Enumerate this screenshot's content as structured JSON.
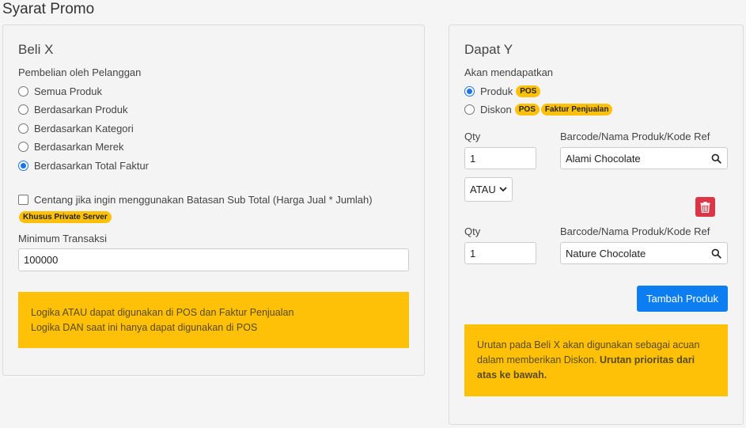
{
  "page": {
    "title": "Syarat Promo"
  },
  "left": {
    "title": "Beli X",
    "purchase_label": "Pembelian oleh Pelanggan",
    "options": [
      {
        "label": "Semua Produk",
        "checked": false
      },
      {
        "label": "Berdasarkan Produk",
        "checked": false
      },
      {
        "label": "Berdasarkan Kategori",
        "checked": false
      },
      {
        "label": "Berdasarkan Merek",
        "checked": false
      },
      {
        "label": "Berdasarkan Total Faktur",
        "checked": true
      }
    ],
    "checkbox_label": "Centang jika ingin menggunakan Batasan Sub Total (Harga Jual * Jumlah)",
    "private_badge": "Khusus Private Server",
    "min_label": "Minimum Transaksi",
    "min_value": "100000",
    "alert_line1": "Logika ATAU dapat digunakan di POS dan Faktur Penjualan",
    "alert_line2": "Logika DAN saat ini hanya dapat digunakan di POS"
  },
  "right": {
    "title": "Dapat Y",
    "get_label": "Akan mendapatkan",
    "opt_product": "Produk",
    "opt_discount": "Diskon",
    "badge_pos": "POS",
    "badge_faktur": "Faktur Penjualan",
    "qty_label": "Qty",
    "barcode_label": "Barcode/Nama Produk/Kode Ref",
    "items": [
      {
        "qty": "1",
        "product": "Alami Chocolate"
      },
      {
        "qty": "1",
        "product": "Nature Chocolate"
      }
    ],
    "logic_select": "ATAU",
    "add_button": "Tambah Produk",
    "alert_text": "Urutan pada Beli X akan digunakan sebagai acuan dalam memberikan Diskon.",
    "alert_bold": "Urutan prioritas dari atas ke bawah."
  },
  "colors": {
    "accent": "#0d7ef2",
    "warning": "#ffc107",
    "danger": "#dc3545"
  }
}
